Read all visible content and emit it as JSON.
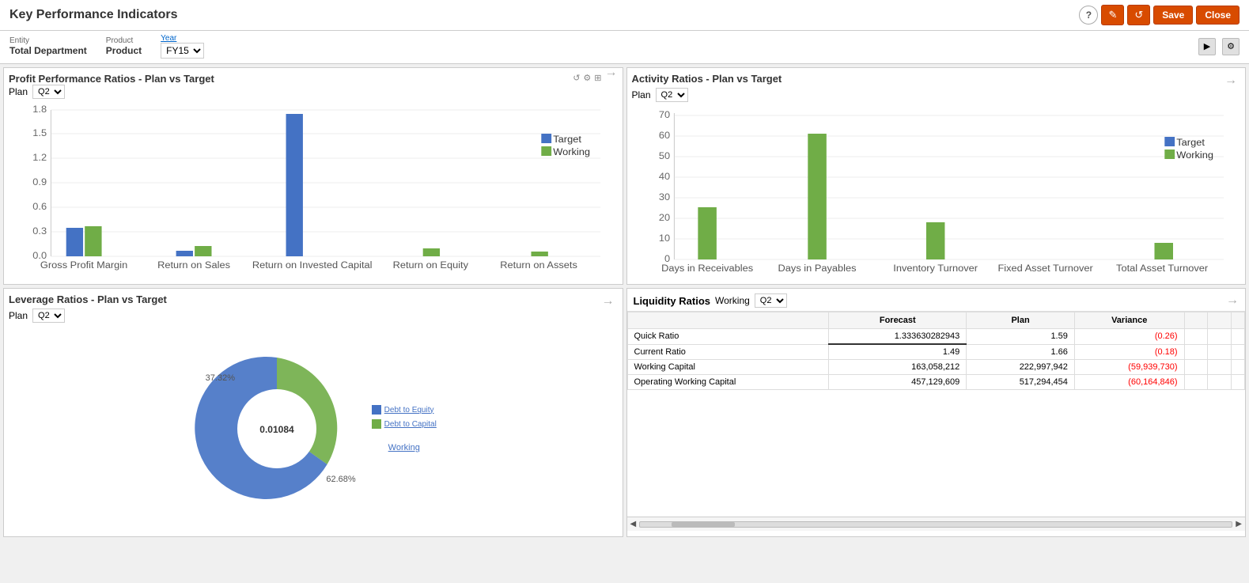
{
  "header": {
    "title": "Key Performance Indicators",
    "help_label": "?",
    "edit_icon": "✎",
    "refresh_icon": "↺",
    "save_label": "Save",
    "close_label": "Close"
  },
  "filters": {
    "entity_label": "Entity",
    "entity_value": "Total Department",
    "product_label": "Product",
    "product_value": "Product",
    "year_label": "Year",
    "year_value": "FY15"
  },
  "profit_panel": {
    "title": "Profit Performance Ratios - Plan vs Target",
    "plan_label": "Plan",
    "plan_value": "Q2",
    "arrow_label": "→",
    "legend": {
      "target_color": "#4472C4",
      "working_color": "#70AD47",
      "target_label": "Target",
      "working_label": "Working"
    },
    "bars": [
      {
        "label": "Gross Profit Margin",
        "target": 0.35,
        "working": 0.37
      },
      {
        "label": "Return on Sales",
        "target": 0.07,
        "working": 0.13
      },
      {
        "label": "Return on Invested Capital",
        "target": 1.75,
        "working": 0.0
      },
      {
        "label": "Return on Equity",
        "target": 0.0,
        "working": 0.1
      },
      {
        "label": "Return on Assets",
        "target": 0.0,
        "working": 0.06
      }
    ],
    "y_max": 1.8,
    "y_ticks": [
      0.0,
      0.3,
      0.6,
      0.9,
      1.2,
      1.5,
      1.8
    ]
  },
  "activity_panel": {
    "title": "Activity Ratios - Plan vs Target",
    "plan_label": "Plan",
    "plan_value": "Q2",
    "arrow_label": "→",
    "legend": {
      "target_color": "#4472C4",
      "working_color": "#70AD47",
      "target_label": "Target",
      "working_label": "Working"
    },
    "bars": [
      {
        "label": "Days in Receivables",
        "target": 0,
        "working": 25
      },
      {
        "label": "Days in Payables",
        "target": 0,
        "working": 60
      },
      {
        "label": "Inventory Turnover",
        "target": 0,
        "working": 18
      },
      {
        "label": "Fixed Asset Turnover",
        "target": 0,
        "working": 0
      },
      {
        "label": "Total Asset Turnover",
        "target": 0,
        "working": 8
      }
    ],
    "y_max": 70,
    "y_ticks": [
      0,
      10,
      20,
      30,
      40,
      50,
      60,
      70
    ]
  },
  "leverage_panel": {
    "title": "Leverage Ratios - Plan vs Target",
    "plan_label": "Plan",
    "plan_value": "Q2",
    "arrow_label": "→",
    "donut": {
      "center_label": "0.01084",
      "segment1_pct": 37.32,
      "segment1_label": "37.32%",
      "segment2_pct": 62.68,
      "segment2_label": "62.68%",
      "segment1_color": "#70AD47",
      "segment2_color": "#4472C4"
    },
    "working_label": "Working",
    "legend": {
      "debt_equity_color": "#4472C4",
      "debt_equity_label": "Debt to Equity",
      "debt_capital_color": "#70AD47",
      "debt_capital_label": "Debt to Capital"
    }
  },
  "liquidity_panel": {
    "title": "Liquidity Ratios",
    "working_label": "Working",
    "period_value": "Q2",
    "columns": [
      "",
      "Forecast",
      "Plan",
      "Variance"
    ],
    "rows": [
      {
        "label": "Quick Ratio",
        "forecast": "1.333630282943",
        "plan": "1.59",
        "variance": "(0.26)",
        "variance_neg": true
      },
      {
        "label": "Current Ratio",
        "forecast": "1.49",
        "plan": "1.66",
        "variance": "(0.18)",
        "variance_neg": true
      },
      {
        "label": "Working Capital",
        "forecast": "163,058,212",
        "plan": "222,997,942",
        "variance": "(59,939,730)",
        "variance_neg": true
      },
      {
        "label": "Operating Working Capital",
        "forecast": "457,129,609",
        "plan": "517,294,454",
        "variance": "(60,164,846)",
        "variance_neg": true
      }
    ]
  }
}
